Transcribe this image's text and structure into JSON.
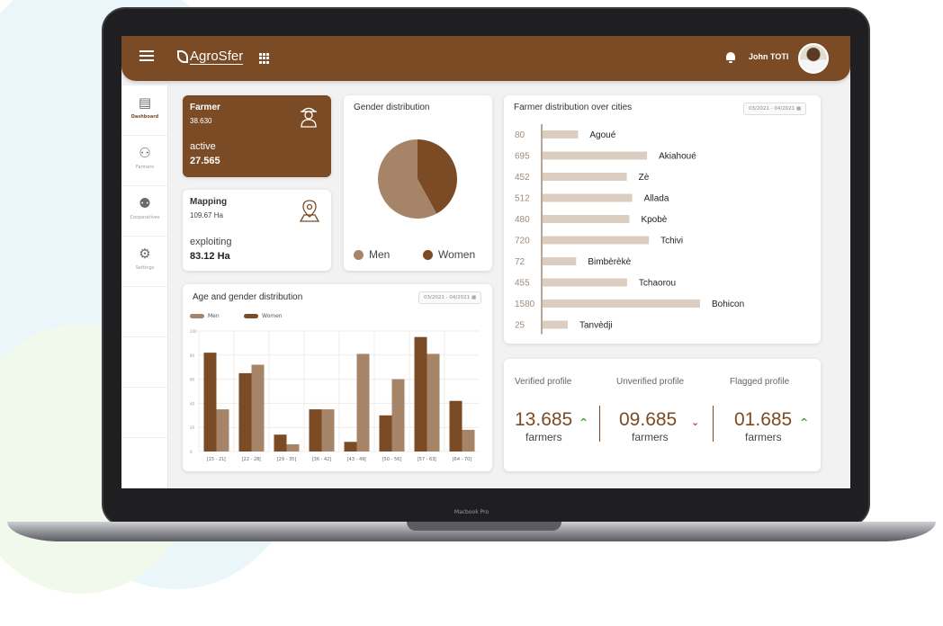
{
  "app": {
    "brand": "AgroSfer",
    "user_name": "John TOTI",
    "device_label": "Macbook Pro"
  },
  "colors": {
    "brand_brown": "#7a4b25",
    "men_color": "#a58468",
    "women_color": "#7a4b25",
    "bar_light": "#dccdc1",
    "up_green": "#3a9a3a",
    "down_red": "#d33030"
  },
  "icons": {
    "menu": "hamburger-menu-icon",
    "apps": "apps-grid-icon",
    "notifications": "bell-icon",
    "farmer": "farmer-icon",
    "map": "map-pin-icon",
    "calendar": "calendar-icon"
  },
  "sidebar": {
    "items": [
      {
        "label": "Dashboard",
        "icon": "dashboard-icon",
        "active": true
      },
      {
        "label": "Farmers",
        "icon": "farmer-icon",
        "active": false
      },
      {
        "label": "Cooperatives",
        "icon": "cooperative-icon",
        "active": false
      },
      {
        "label": "Settings",
        "icon": "gear-icon",
        "active": false
      }
    ]
  },
  "farmer_card": {
    "title": "Farmer",
    "count": "38.630",
    "label": "active",
    "value": "27.565"
  },
  "mapping_card": {
    "title": "Mapping",
    "area": "109.67 Ha",
    "label": "exploiting",
    "value": "83.12 Ha"
  },
  "gender_card": {
    "title": "Gender distribution",
    "legend": [
      "Men",
      "Women"
    ]
  },
  "age_card": {
    "title": "Age and gender distribution",
    "date_range": "03/2021 - 04/2021",
    "legend": [
      "Men",
      "Women"
    ]
  },
  "city_card": {
    "title": "Farmer distribution over cities",
    "date_range": "03/2021 - 04/2021"
  },
  "profiles": [
    {
      "label": "Verified profile",
      "value": "13.685",
      "unit": "farmers",
      "trend": "up"
    },
    {
      "label": "Unverified profile",
      "value": "09.685",
      "unit": "farmers",
      "trend": "down"
    },
    {
      "label": "Flagged profile",
      "value": "01.685",
      "unit": "farmers",
      "trend": "up"
    }
  ],
  "chart_data": [
    {
      "type": "pie",
      "title": "Gender distribution",
      "series": [
        {
          "name": "Men",
          "value": 58
        },
        {
          "name": "Women",
          "value": 42
        }
      ]
    },
    {
      "type": "bar",
      "title": "Age and gender distribution",
      "categories": [
        "[15 - 21[",
        "[22 - 28[",
        "[29 - 35]",
        "[36 - 42]",
        "[43 - 49[",
        "[50 - 56]",
        "[57 - 63[",
        "[64 - 70]"
      ],
      "series": [
        {
          "name": "Women",
          "values": [
            82,
            65,
            14,
            35,
            8,
            30,
            95,
            42
          ]
        },
        {
          "name": "Men",
          "values": [
            35,
            72,
            6,
            35,
            81,
            60,
            81,
            18
          ]
        }
      ],
      "yticks": [
        "100",
        "80",
        "60",
        "40",
        "20",
        "0"
      ],
      "ylim": [
        0,
        100
      ]
    },
    {
      "type": "bar",
      "orientation": "horizontal",
      "title": "Farmer distribution over cities",
      "categories": [
        "Agoué",
        "Akiahoué",
        "Zè",
        "Allada",
        "Kpobè",
        "Tchivi",
        "Bimbèrèkè",
        "Tchaorou",
        "Bohicon",
        "Tanvèdji"
      ],
      "values": [
        80,
        695,
        452,
        512,
        480,
        720,
        72,
        455,
        1580,
        25
      ],
      "value_labels": [
        "80",
        "695",
        "452",
        "512",
        "480",
        "720",
        "72",
        "455",
        "1580",
        "25"
      ]
    }
  ]
}
